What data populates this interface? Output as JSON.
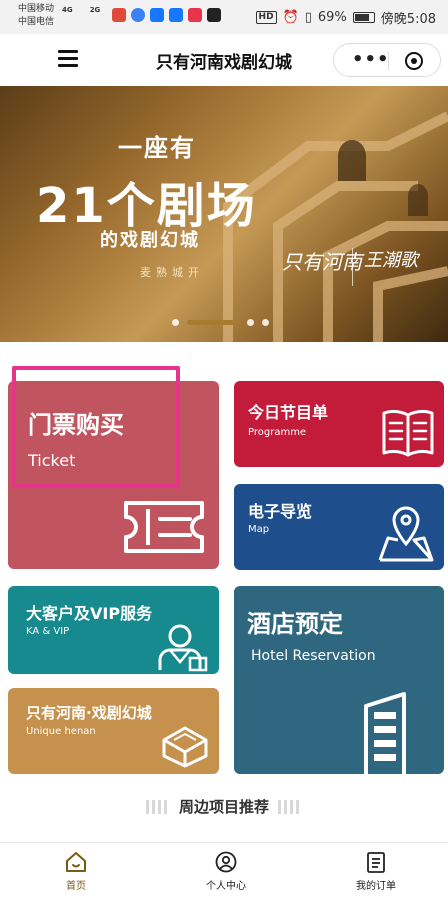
{
  "status_bar": {
    "carrier_1": "中国移动",
    "carrier_2": "中国电信",
    "net_1": "4G",
    "net_2": "2G",
    "hd": "HD",
    "battery": "69%",
    "time": "傍晚5:08"
  },
  "nav": {
    "title": "只有河南戏剧幻城",
    "more_glyph": "•••"
  },
  "banner": {
    "line1": "一座有",
    "line2": "21个剧场",
    "line3": "的戏剧幻城",
    "line4": "麦熟城开",
    "logo1": "只有河南",
    "logo2": "王潮歌",
    "slide_count": 4,
    "active_slide": 2
  },
  "tiles": {
    "ticket": {
      "title": "门票购买",
      "sub": "Ticket"
    },
    "programme": {
      "title": "今日节目单",
      "sub": "Programme"
    },
    "map": {
      "title": "电子导览",
      "sub": "Map"
    },
    "vip": {
      "title": "大客户及VIP服务",
      "sub": "KA & VIP"
    },
    "unique": {
      "title": "只有河南·戏剧幻城",
      "sub": "Unique henan"
    },
    "hotel": {
      "title": "酒店预定",
      "sub": "Hotel Reservation"
    }
  },
  "section": {
    "title": "周边项目推荐"
  },
  "tabbar": {
    "home": "首页",
    "profile": "个人中心",
    "orders": "我的订单"
  },
  "colors": {
    "ticket": "#c0545f",
    "programme": "#c31c3a",
    "map": "#1f4e8c",
    "vip": "#178a8f",
    "unique": "#c6914c",
    "hotel": "#2f6781",
    "highlight": "#e8338a"
  }
}
